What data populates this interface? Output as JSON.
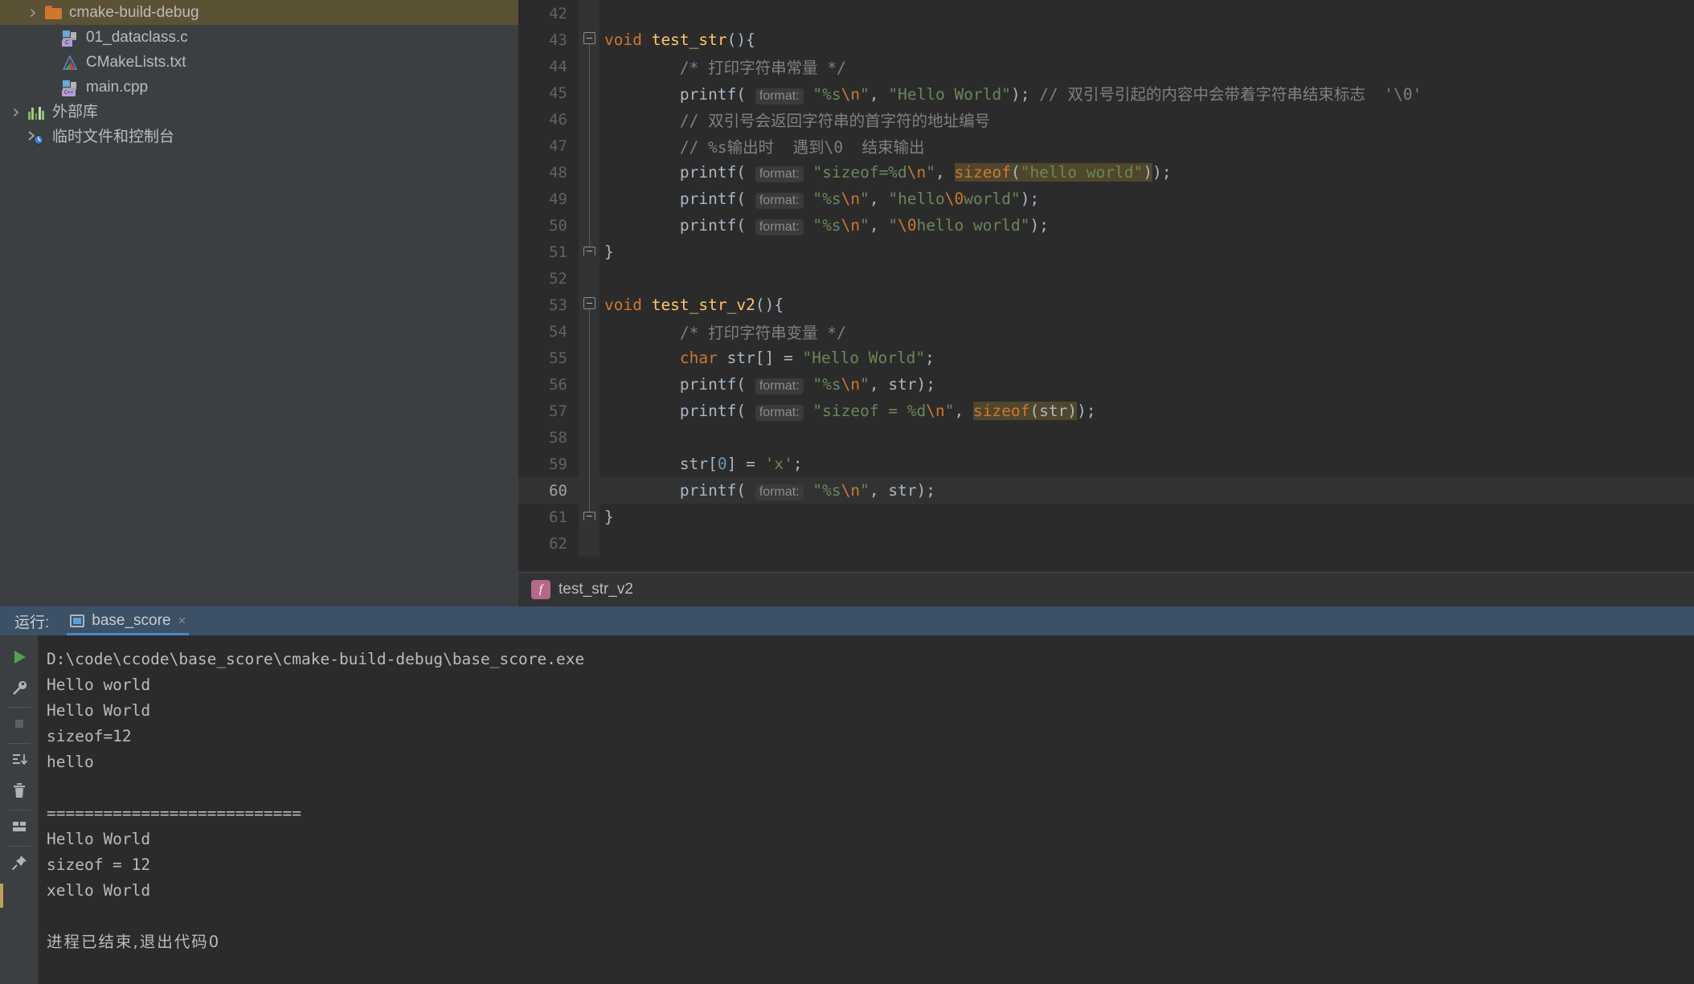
{
  "project_tree": {
    "items": [
      {
        "label": "cmake-build-debug",
        "icon": "folder-icon",
        "arrow": true,
        "indent": 1,
        "selected": true
      },
      {
        "label": "01_dataclass.c",
        "icon": "c-file-icon",
        "arrow": false,
        "indent": 2,
        "selected": false
      },
      {
        "label": "CMakeLists.txt",
        "icon": "cmake-file-icon",
        "arrow": false,
        "indent": 2,
        "selected": false
      },
      {
        "label": "main.cpp",
        "icon": "cpp-file-icon",
        "arrow": false,
        "indent": 2,
        "selected": false
      },
      {
        "label": "外部库",
        "icon": "library-icon",
        "arrow": true,
        "indent": 0,
        "selected": false
      },
      {
        "label": "临时文件和控制台",
        "icon": "scratch-console-icon",
        "arrow": false,
        "indent": 0,
        "selected": false
      }
    ]
  },
  "editor": {
    "lines": [
      {
        "num": "42",
        "fold": "none",
        "current": false,
        "tokens": []
      },
      {
        "num": "43",
        "fold": "open",
        "current": false,
        "tokens": [
          {
            "t": "void ",
            "c": "kw"
          },
          {
            "t": "test_str",
            "c": "fn"
          },
          {
            "t": "(){",
            "c": "plain"
          }
        ]
      },
      {
        "num": "44",
        "fold": "line",
        "current": false,
        "tokens": [
          {
            "t": "        /* 打印字符串常量 */",
            "c": "cmt"
          }
        ]
      },
      {
        "num": "45",
        "fold": "line",
        "current": false,
        "tokens": [
          {
            "t": "        printf",
            "c": "plain"
          },
          {
            "t": "(",
            "c": "plain"
          },
          {
            "t": " ",
            "c": "plain"
          },
          {
            "t": "format:",
            "c": "hint"
          },
          {
            "t": " ",
            "c": "plain"
          },
          {
            "t": "\"%s",
            "c": "str"
          },
          {
            "t": "\\n",
            "c": "esc"
          },
          {
            "t": "\"",
            "c": "str"
          },
          {
            "t": ", ",
            "c": "plain"
          },
          {
            "t": "\"Hello World\"",
            "c": "str"
          },
          {
            "t": ");",
            "c": "plain"
          },
          {
            "t": " // 双引号引起的内容中会带着字符串结束标志  '\\0'",
            "c": "cmt"
          }
        ]
      },
      {
        "num": "46",
        "fold": "line",
        "current": false,
        "tokens": [
          {
            "t": "        // 双引号会返回字符串的首字符的地址编号",
            "c": "cmt"
          }
        ]
      },
      {
        "num": "47",
        "fold": "line",
        "current": false,
        "tokens": [
          {
            "t": "        // %s输出时  遇到\\0  结束输出",
            "c": "cmt"
          }
        ]
      },
      {
        "num": "48",
        "fold": "line",
        "current": false,
        "tokens": [
          {
            "t": "        printf( ",
            "c": "plain"
          },
          {
            "t": "format:",
            "c": "hint"
          },
          {
            "t": " ",
            "c": "plain"
          },
          {
            "t": "\"sizeof=%d",
            "c": "str"
          },
          {
            "t": "\\n",
            "c": "esc"
          },
          {
            "t": "\"",
            "c": "str"
          },
          {
            "t": ", ",
            "c": "plain"
          },
          {
            "t": "sizeof",
            "c": "kw",
            "hl": true
          },
          {
            "t": "(",
            "c": "plain",
            "hl": true
          },
          {
            "t": "\"hello world\"",
            "c": "str",
            "hl": true
          },
          {
            "t": ")",
            "c": "plain",
            "hl": true
          },
          {
            "t": ");",
            "c": "plain"
          }
        ]
      },
      {
        "num": "49",
        "fold": "line",
        "current": false,
        "tokens": [
          {
            "t": "        printf( ",
            "c": "plain"
          },
          {
            "t": "format:",
            "c": "hint"
          },
          {
            "t": " ",
            "c": "plain"
          },
          {
            "t": "\"%s",
            "c": "str"
          },
          {
            "t": "\\n",
            "c": "esc"
          },
          {
            "t": "\"",
            "c": "str"
          },
          {
            "t": ", ",
            "c": "plain"
          },
          {
            "t": "\"hello",
            "c": "str"
          },
          {
            "t": "\\0",
            "c": "esc"
          },
          {
            "t": "world\"",
            "c": "str"
          },
          {
            "t": ");",
            "c": "plain"
          }
        ]
      },
      {
        "num": "50",
        "fold": "line",
        "current": false,
        "tokens": [
          {
            "t": "        printf( ",
            "c": "plain"
          },
          {
            "t": "format:",
            "c": "hint"
          },
          {
            "t": " ",
            "c": "plain"
          },
          {
            "t": "\"%s",
            "c": "str"
          },
          {
            "t": "\\n",
            "c": "esc"
          },
          {
            "t": "\"",
            "c": "str"
          },
          {
            "t": ", ",
            "c": "plain"
          },
          {
            "t": "\"",
            "c": "str"
          },
          {
            "t": "\\0",
            "c": "esc"
          },
          {
            "t": "hello world\"",
            "c": "str"
          },
          {
            "t": ");",
            "c": "plain"
          }
        ]
      },
      {
        "num": "51",
        "fold": "end",
        "current": false,
        "tokens": [
          {
            "t": "}",
            "c": "plain"
          }
        ]
      },
      {
        "num": "52",
        "fold": "none",
        "current": false,
        "tokens": []
      },
      {
        "num": "53",
        "fold": "open",
        "current": false,
        "tokens": [
          {
            "t": "void ",
            "c": "kw"
          },
          {
            "t": "test_str_v2",
            "c": "fn"
          },
          {
            "t": "(){",
            "c": "plain"
          }
        ]
      },
      {
        "num": "54",
        "fold": "line",
        "current": false,
        "tokens": [
          {
            "t": "        /* 打印字符串变量 */",
            "c": "cmt"
          }
        ]
      },
      {
        "num": "55",
        "fold": "line",
        "current": false,
        "tokens": [
          {
            "t": "        ",
            "c": "plain"
          },
          {
            "t": "char ",
            "c": "kw"
          },
          {
            "t": "str[] = ",
            "c": "plain"
          },
          {
            "t": "\"Hello World\"",
            "c": "str"
          },
          {
            "t": ";",
            "c": "plain"
          }
        ]
      },
      {
        "num": "56",
        "fold": "line",
        "current": false,
        "tokens": [
          {
            "t": "        printf( ",
            "c": "plain"
          },
          {
            "t": "format:",
            "c": "hint"
          },
          {
            "t": " ",
            "c": "plain"
          },
          {
            "t": "\"%s",
            "c": "str"
          },
          {
            "t": "\\n",
            "c": "esc"
          },
          {
            "t": "\"",
            "c": "str"
          },
          {
            "t": ", str);",
            "c": "plain"
          }
        ]
      },
      {
        "num": "57",
        "fold": "line",
        "current": false,
        "tokens": [
          {
            "t": "        printf( ",
            "c": "plain"
          },
          {
            "t": "format:",
            "c": "hint"
          },
          {
            "t": " ",
            "c": "plain"
          },
          {
            "t": "\"sizeof = %d",
            "c": "str"
          },
          {
            "t": "\\n",
            "c": "esc"
          },
          {
            "t": "\"",
            "c": "str"
          },
          {
            "t": ", ",
            "c": "plain"
          },
          {
            "t": "sizeof",
            "c": "kw",
            "hl": true
          },
          {
            "t": "(str)",
            "c": "plain",
            "hl": true
          },
          {
            "t": ");",
            "c": "plain"
          }
        ]
      },
      {
        "num": "58",
        "fold": "line",
        "current": false,
        "tokens": []
      },
      {
        "num": "59",
        "fold": "line",
        "current": false,
        "tokens": [
          {
            "t": "        str[",
            "c": "plain"
          },
          {
            "t": "0",
            "c": "num"
          },
          {
            "t": "] = ",
            "c": "plain"
          },
          {
            "t": "'x'",
            "c": "str"
          },
          {
            "t": ";",
            "c": "plain"
          }
        ]
      },
      {
        "num": "60",
        "fold": "line",
        "current": true,
        "tokens": [
          {
            "t": "        printf( ",
            "c": "plain"
          },
          {
            "t": "format:",
            "c": "hint"
          },
          {
            "t": " ",
            "c": "plain"
          },
          {
            "t": "\"%s",
            "c": "str"
          },
          {
            "t": "\\n",
            "c": "esc"
          },
          {
            "t": "\"",
            "c": "str"
          },
          {
            "t": ", str);",
            "c": "plain"
          }
        ]
      },
      {
        "num": "61",
        "fold": "end",
        "current": false,
        "tokens": [
          {
            "t": "}",
            "c": "plain"
          }
        ]
      },
      {
        "num": "62",
        "fold": "none",
        "current": false,
        "tokens": []
      }
    ],
    "breadcrumb": {
      "icon": "function-icon",
      "icon_glyph": "f",
      "label": "test_str_v2"
    }
  },
  "run_panel": {
    "title": "运行:",
    "tab_label": "base_score",
    "tab_close": "×",
    "toolbar": [
      {
        "name": "rerun-button",
        "icon": "play-icon"
      },
      {
        "name": "settings-button",
        "icon": "wrench-icon"
      },
      {
        "name": "stop-button",
        "icon": "stop-square-icon"
      },
      {
        "name": "scroll-to-end-button",
        "icon": "scroll-to-end-icon"
      },
      {
        "name": "clear-all-button",
        "icon": "trash-icon"
      },
      {
        "name": "layout-button",
        "icon": "layout-icon"
      },
      {
        "name": "pin-tab-button",
        "icon": "pin-icon"
      }
    ],
    "console_lines": [
      {
        "text": "D:\\code\\ccode\\base_score\\cmake-build-debug\\base_score.exe",
        "cn": false
      },
      {
        "text": "Hello world",
        "cn": false
      },
      {
        "text": "Hello World",
        "cn": false
      },
      {
        "text": "sizeof=12",
        "cn": false
      },
      {
        "text": "hello",
        "cn": false
      },
      {
        "text": "",
        "cn": false
      },
      {
        "text": "===========================",
        "cn": false
      },
      {
        "text": "Hello World",
        "cn": false
      },
      {
        "text": "sizeof = 12",
        "cn": false
      },
      {
        "text": "xello World",
        "cn": false
      },
      {
        "text": "",
        "cn": false
      },
      {
        "text": "进程已结束,退出代码0",
        "cn": true
      }
    ]
  },
  "colors": {
    "editor_bg": "#2b2b2b",
    "panel_bg": "#3c3f41",
    "selection": "#5b5135",
    "run_header": "#3c5066",
    "accent": "#4a88c7",
    "keyword": "#cc7832",
    "string": "#6a8759",
    "comment": "#808080",
    "function": "#ffc66d",
    "usage_highlight": "#50462b"
  }
}
